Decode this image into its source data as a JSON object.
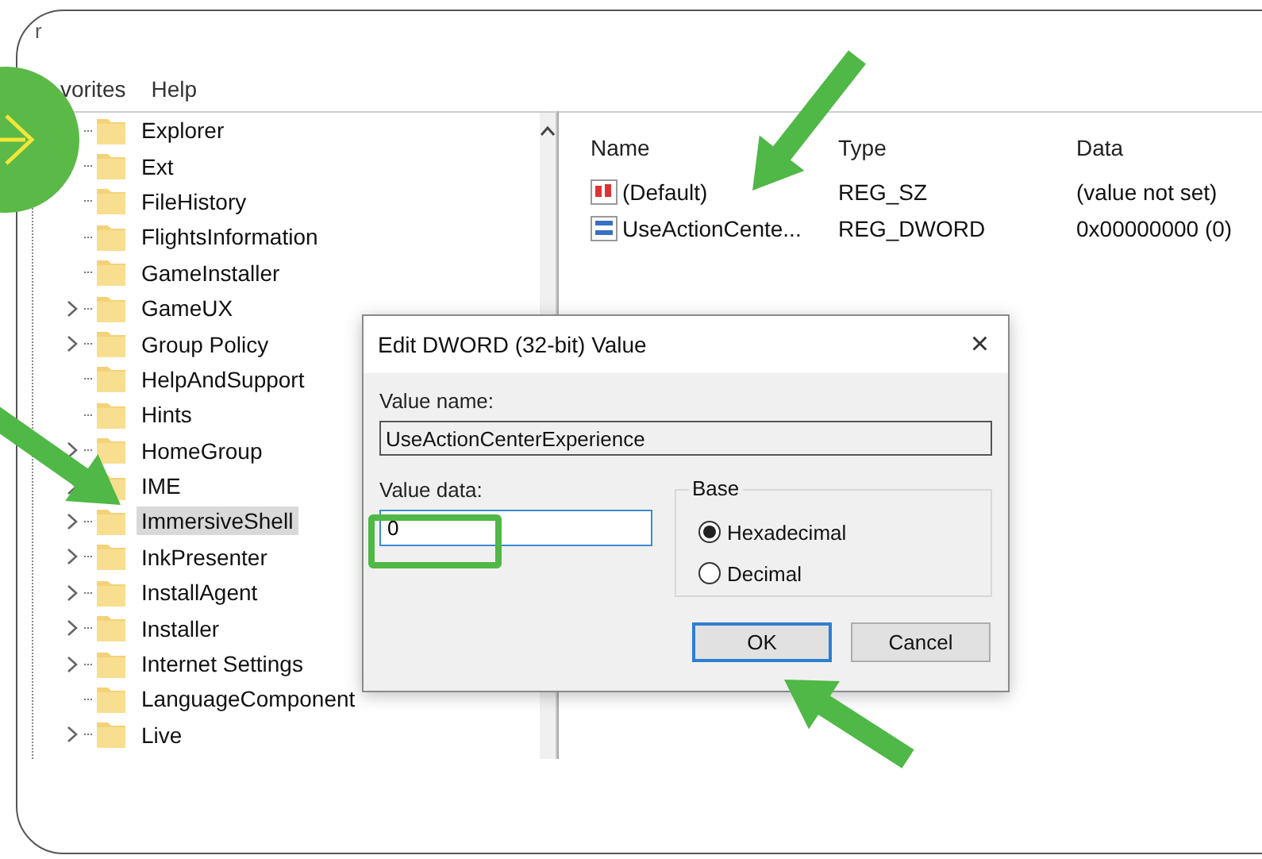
{
  "window": {
    "title": "r"
  },
  "menu": [
    {
      "label": "vorites"
    },
    {
      "label": "Help"
    }
  ],
  "tree": {
    "items": [
      {
        "label": "Explorer",
        "expandable": false,
        "selected": false
      },
      {
        "label": "Ext",
        "expandable": false,
        "selected": false
      },
      {
        "label": "FileHistory",
        "expandable": false,
        "selected": false
      },
      {
        "label": "FlightsInformation",
        "expandable": false,
        "selected": false
      },
      {
        "label": "GameInstaller",
        "expandable": false,
        "selected": false
      },
      {
        "label": "GameUX",
        "expandable": true,
        "selected": false
      },
      {
        "label": "Group Policy",
        "expandable": true,
        "selected": false
      },
      {
        "label": "HelpAndSupport",
        "expandable": false,
        "selected": false
      },
      {
        "label": "Hints",
        "expandable": false,
        "selected": false
      },
      {
        "label": "HomeGroup",
        "expandable": true,
        "selected": false
      },
      {
        "label": "IME",
        "expandable": true,
        "selected": false
      },
      {
        "label": "ImmersiveShell",
        "expandable": true,
        "selected": true
      },
      {
        "label": "InkPresenter",
        "expandable": true,
        "selected": false
      },
      {
        "label": "InstallAgent",
        "expandable": true,
        "selected": false
      },
      {
        "label": "Installer",
        "expandable": true,
        "selected": false
      },
      {
        "label": "Internet Settings",
        "expandable": true,
        "selected": false
      },
      {
        "label": "LanguageComponent",
        "expandable": false,
        "selected": false
      },
      {
        "label": "Live",
        "expandable": true,
        "selected": false
      }
    ]
  },
  "values": {
    "columns": [
      "Name",
      "Type",
      "Data"
    ],
    "rows": [
      {
        "kind": "string",
        "name": "(Default)",
        "type": "REG_SZ",
        "data": "(value not set)"
      },
      {
        "kind": "dword",
        "name": "UseActionCente...",
        "type": "REG_DWORD",
        "data": "0x00000000 (0)"
      }
    ]
  },
  "dialog": {
    "title": "Edit DWORD (32-bit) Value",
    "close": "×",
    "value_name_label": "Value name:",
    "value_name": "UseActionCenterExperience",
    "value_data_label": "Value data:",
    "value_data": "0",
    "base_label": "Base",
    "bases": [
      {
        "label": "Hexadecimal",
        "selected": true
      },
      {
        "label": "Decimal",
        "selected": false
      }
    ],
    "buttons": [
      {
        "label": "OK",
        "focused": true
      },
      {
        "label": "Cancel",
        "focused": false
      }
    ]
  }
}
